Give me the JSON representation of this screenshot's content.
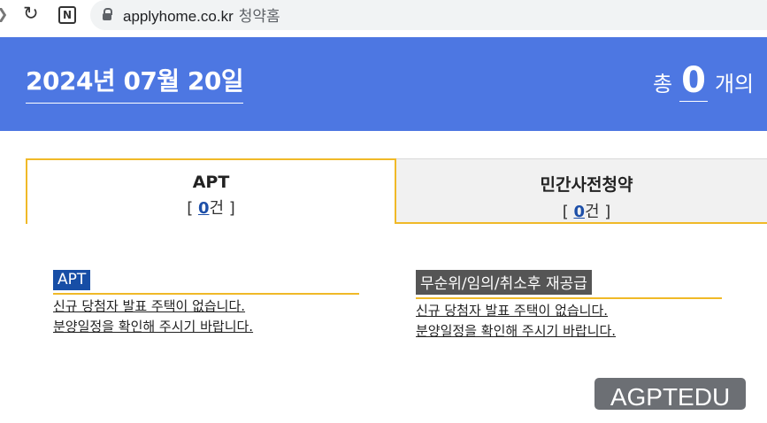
{
  "browser": {
    "url": "applyhome.co.kr",
    "page_title": "청약홈"
  },
  "banner": {
    "date": "2024년 07월 20일",
    "total_prefix": "총",
    "total_count": "0",
    "total_suffix": "개의"
  },
  "tabs": [
    {
      "title": "APT",
      "count_open": "[ ",
      "count": "0",
      "count_close": "건 ]",
      "active": true
    },
    {
      "title": "민간사전청약",
      "count_open": "[ ",
      "count": "0",
      "count_close": "건 ]",
      "active": false
    }
  ],
  "sections": [
    {
      "label": "APT",
      "messages": [
        "신규 당첨자 발표 주택이 없습니다.",
        "분양일정을 확인해 주시기 바랍니다."
      ]
    },
    {
      "label": "무순위/임의/취소후 재공급",
      "messages": [
        "신규 당첨자 발표 주택이 없습니다.",
        "분양일정을 확인해 주시기 바랍니다."
      ]
    }
  ],
  "watermark": "AGPTEDU",
  "colors": {
    "banner": "#4d77e2",
    "tab_accent": "#f0b928",
    "apt_label": "#174ea6",
    "resupply_label": "#555555"
  }
}
